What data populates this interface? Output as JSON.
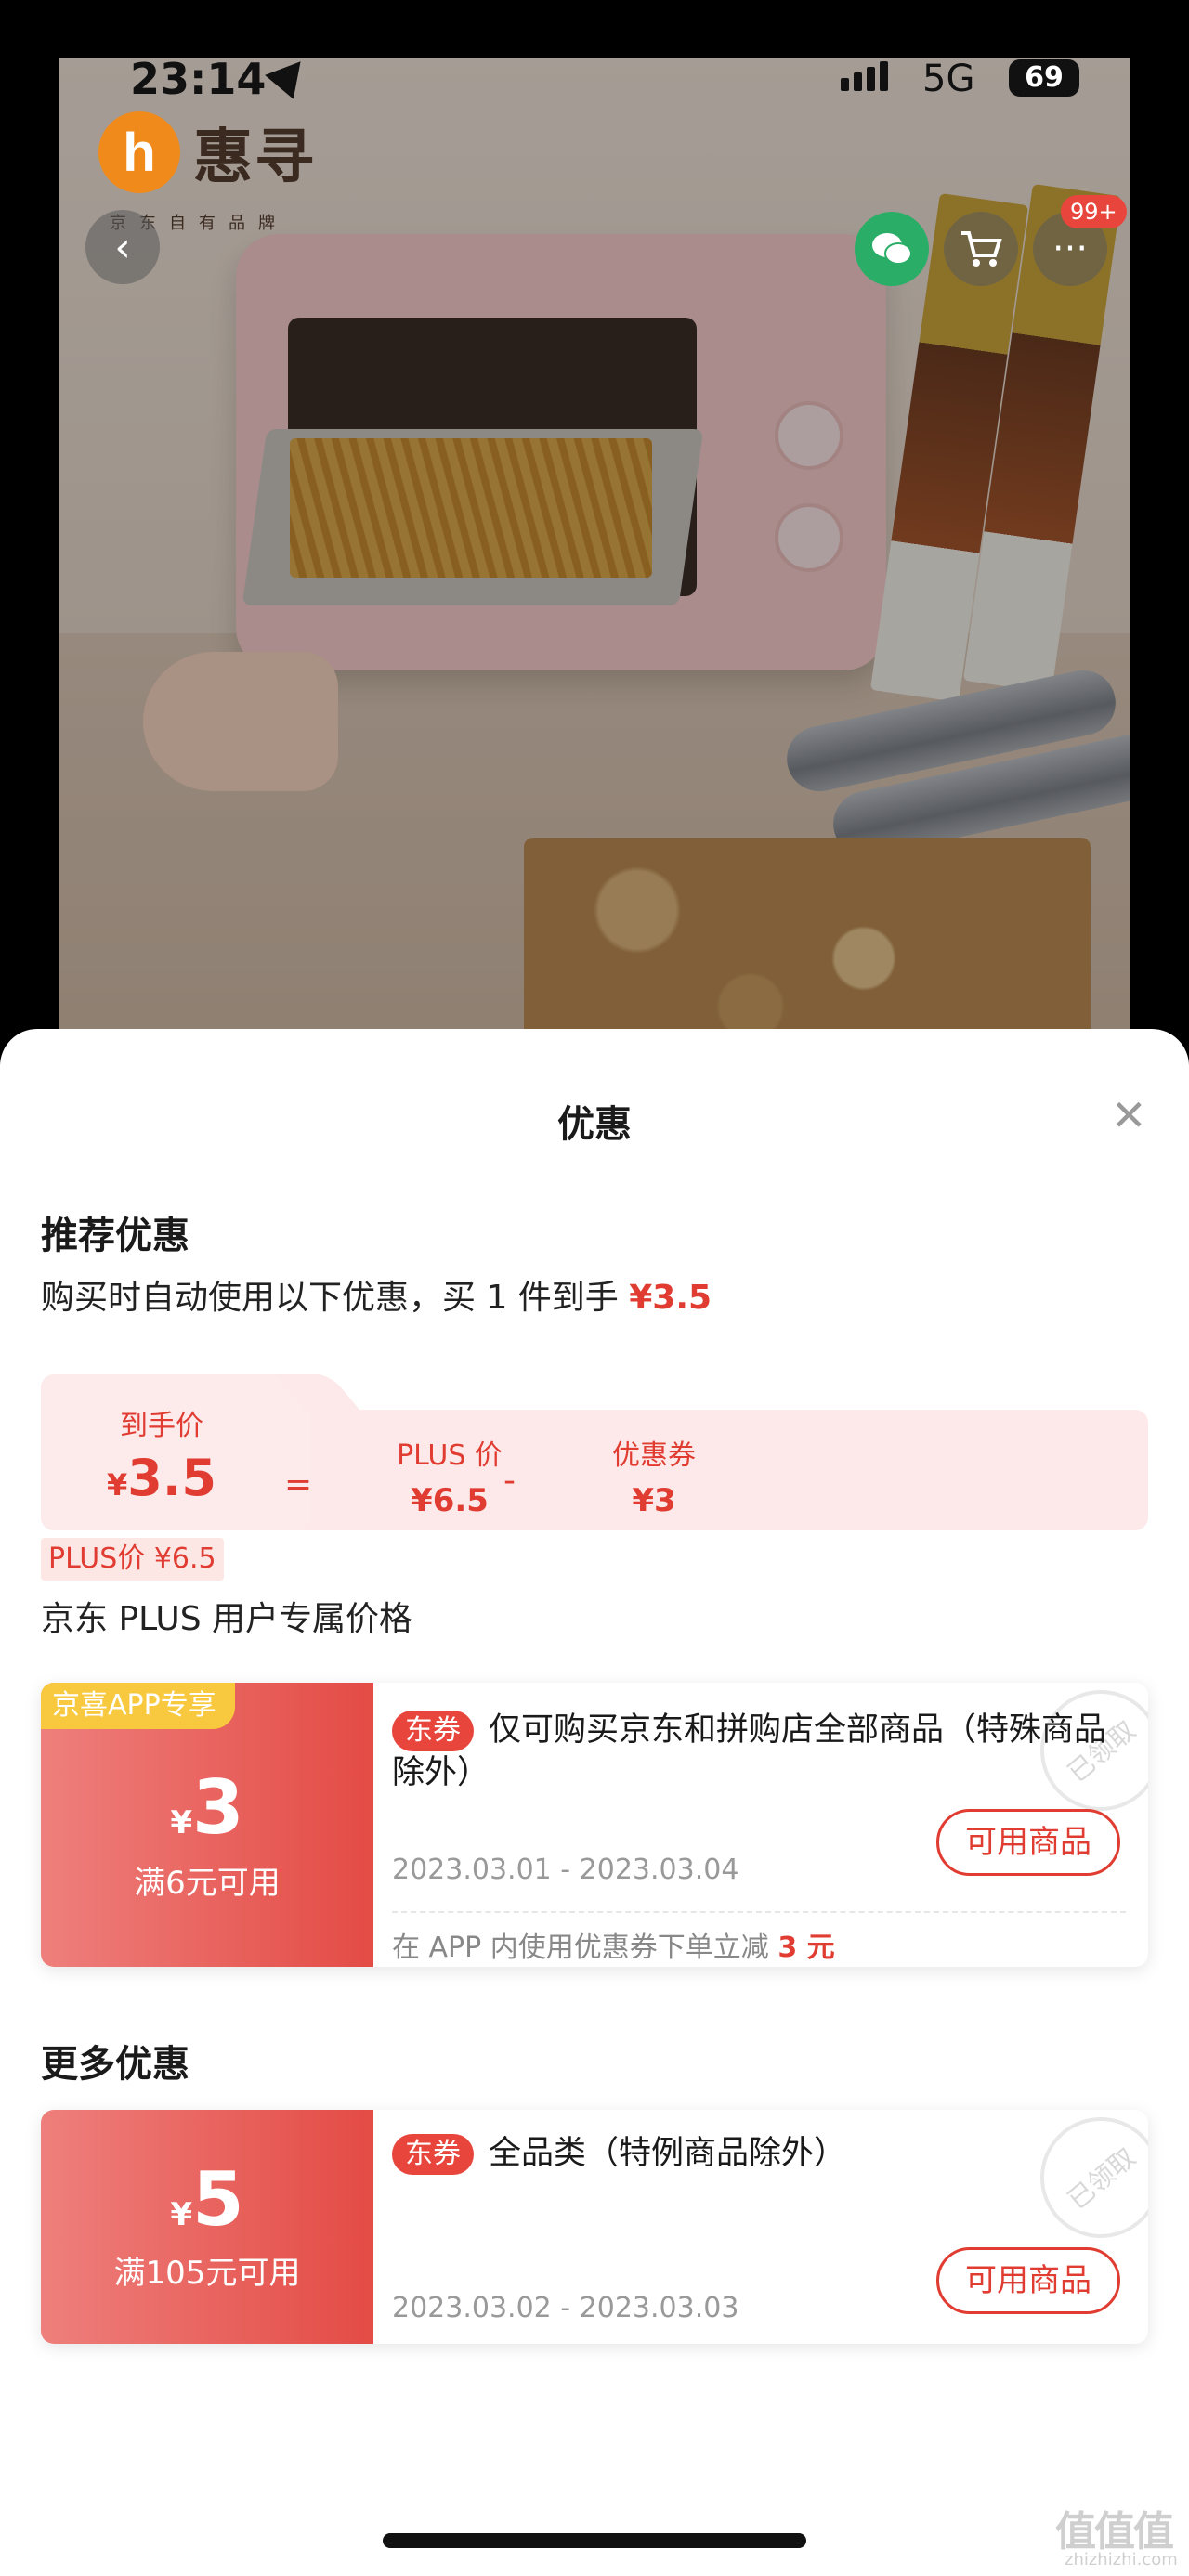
{
  "status_bar": {
    "time": "23:14",
    "network": "5G",
    "battery": "69"
  },
  "hero": {
    "brand_name": "惠寻",
    "brand_logo_letter": "h",
    "brand_sub": "京东自有品牌",
    "cart_badge": "99+",
    "icons": [
      "chevron-left-icon",
      "wechat-icon",
      "cart-icon",
      "more-icon"
    ]
  },
  "sheet": {
    "title": "优惠",
    "close": "✕",
    "recommended": {
      "title": "推荐优惠",
      "desc_prefix": "购买时自动使用以下优惠，买 1 件到手",
      "desc_price": "¥3.5",
      "calc": {
        "final_label": "到手价",
        "final_currency": "¥",
        "final_value": "3.5",
        "equals": "=",
        "plus_label": "PLUS 价",
        "plus_value": "¥6.5",
        "minus": "-",
        "coupon_label": "优惠券",
        "coupon_value": "¥3"
      },
      "plus_tag": "PLUS价 ¥6.5",
      "plus_desc": "京东 PLUS 用户专属价格"
    },
    "coupons": [
      {
        "tag": "京喜APP专享",
        "currency": "¥",
        "amount": "3",
        "condition": "满6元可用",
        "type_badge": "东券",
        "title": "仅可购买京东和拼购店全部商品（特殊商品除外）",
        "date": "2023.03.01 - 2023.03.04",
        "button": "可用商品",
        "stamp": "已领取",
        "note_prefix": "在 APP 内使用优惠券下单立减",
        "note_value": "3 元"
      }
    ],
    "more": {
      "title": "更多优惠",
      "coupons": [
        {
          "currency": "¥",
          "amount": "5",
          "condition": "满105元可用",
          "type_badge": "东券",
          "title": "全品类（特例商品除外）",
          "date": "2023.03.02 - 2023.03.03",
          "button": "可用商品",
          "stamp": "已领取"
        }
      ]
    }
  },
  "watermark": {
    "text": "值值值",
    "url": "zhizhizhi.com"
  },
  "colors": {
    "accent_red": "#e03c31",
    "coupon_gradient_start": "#ee7f7c",
    "coupon_gradient_end": "#e44b45",
    "app_tag": "#f8c93e",
    "plus_bg": "#fde9e9"
  }
}
